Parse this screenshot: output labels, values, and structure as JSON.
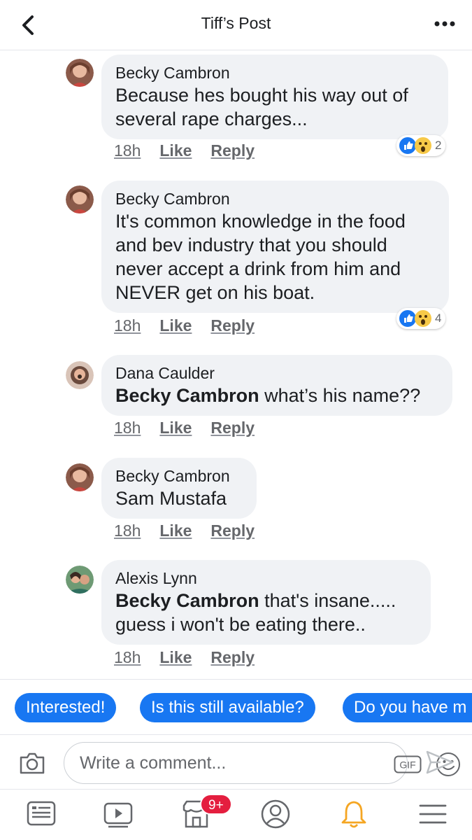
{
  "header": {
    "title": "Tiff’s Post",
    "back_icon": "chevron-left-icon",
    "more_icon": "more-dots-icon"
  },
  "comments": [
    {
      "author": "Becky Cambron",
      "mention": "",
      "lines": [
        "Because hes bought his way out of",
        "several rape charges..."
      ],
      "time": "18h",
      "like": "Like",
      "reply": "Reply",
      "reaction_count": "2"
    },
    {
      "author": "Becky Cambron",
      "mention": "",
      "lines": [
        "It's common knowledge in the food",
        "and bev industry that you should",
        "never accept a drink from him and",
        "NEVER get on his boat."
      ],
      "time": "18h",
      "like": "Like",
      "reply": "Reply",
      "reaction_count": "4"
    },
    {
      "author": "Dana Caulder",
      "mention": "Becky Cambron",
      "lines": [
        " what’s his name??"
      ],
      "time": "18h",
      "like": "Like",
      "reply": "Reply"
    },
    {
      "author": "Becky Cambron",
      "mention": "",
      "lines": [
        "Sam Mustafa"
      ],
      "time": "18h",
      "like": "Like",
      "reply": "Reply"
    },
    {
      "author": "Alexis Lynn",
      "mention": "Becky Cambron",
      "lines": [
        " that's insane.....",
        "guess i won't be eating there.."
      ],
      "time": "18h",
      "like": "Like",
      "reply": "Reply"
    }
  ],
  "quick_replies": [
    "Interested!",
    "Is this still available?",
    "Do you have m"
  ],
  "composer": {
    "placeholder": "Write a comment...",
    "gif_label": "GIF"
  },
  "tabbar": {
    "items": [
      "news-feed-icon",
      "watch-icon",
      "marketplace-icon",
      "profile-icon",
      "notifications-bell-icon",
      "menu-icon"
    ],
    "marketplace_badge": "9+"
  },
  "colors": {
    "accent": "#1877f2",
    "bubble": "#f0f2f5",
    "badge": "#e41e3f",
    "bell_active": "#f5a623"
  }
}
